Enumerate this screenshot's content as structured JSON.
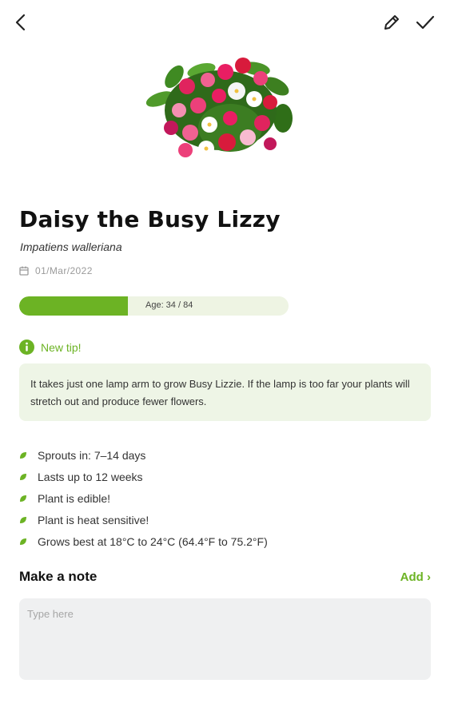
{
  "header": {
    "back_icon": "back-arrow-icon",
    "edit_icon": "pencil-icon",
    "confirm_icon": "checkmark-icon"
  },
  "plant": {
    "name": "Daisy the Busy Lizzy",
    "latin_name": "Impatiens walleriana",
    "date": "01/Mar/2022",
    "date_icon": "calendar-icon",
    "age_label": "Age: 34 / 84",
    "age_current": 34,
    "age_total": 84
  },
  "tip": {
    "label": "New tip!",
    "icon": "info-icon",
    "text": "It takes just one lamp arm to grow Busy Lizzie. If the lamp is too far your plants will stretch out and produce fewer flowers."
  },
  "facts": [
    "Sprouts in: 7–14 days",
    "Lasts up to 12 weeks",
    "Plant is edible!",
    "Plant is heat sensitive!",
    "Grows best at 18°C to 24°C (64.4°F to 75.2°F)"
  ],
  "note": {
    "title": "Make a note",
    "add_label": "Add ›",
    "placeholder": "Type here",
    "value": ""
  },
  "colors": {
    "accent": "#6cb324",
    "tip_background": "#eef5e6",
    "progress_track": "#eef4e3",
    "note_background": "#eff0f1"
  }
}
